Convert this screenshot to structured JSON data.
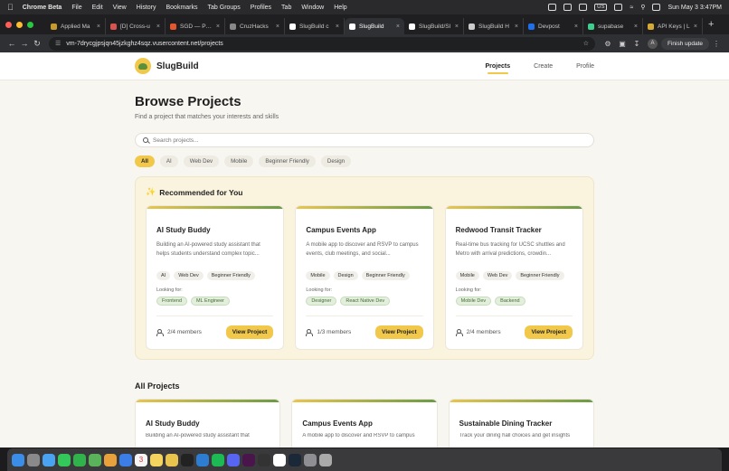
{
  "menubar": {
    "app": "Chrome Beta",
    "items": [
      "File",
      "Edit",
      "View",
      "History",
      "Bookmarks",
      "Tab Groups",
      "Profiles",
      "Tab",
      "Window",
      "Help"
    ],
    "input_source": "US",
    "clock": "Sun May 3  3:47PM"
  },
  "tabs": [
    {
      "label": "Applied Ma",
      "color": "#c79a2e"
    },
    {
      "label": "[D] Cross-u",
      "color": "#d9534f"
    },
    {
      "label": "SGD — PyTo",
      "color": "#e4572e"
    },
    {
      "label": "CruzHacks",
      "color": "#888888"
    },
    {
      "label": "SlugBuild c",
      "color": "#ffffff"
    },
    {
      "label": "SlugBuild",
      "color": "#ffffff"
    },
    {
      "label": "SlugBuild/Sl",
      "color": "#ffffff"
    },
    {
      "label": "SlugBuild H",
      "color": "#cccccc"
    },
    {
      "label": "Devpost",
      "color": "#1f6feb"
    },
    {
      "label": "supabase",
      "color": "#3ecf8e"
    },
    {
      "label": "API Keys | L",
      "color": "#d4a935"
    }
  ],
  "address": {
    "url": "vm-7drycgjpsjqn45jzkghz4sqz.vusercontent.net/projects",
    "update_label": "Finish update",
    "avatar_letter": "A"
  },
  "site": {
    "brand": "SlugBuild",
    "nav": [
      "Projects",
      "Create",
      "Profile"
    ]
  },
  "page": {
    "title": "Browse Projects",
    "subtitle": "Find a project that matches your interests and skills",
    "search_placeholder": "Search projects...",
    "filters": [
      "All",
      "AI",
      "Web Dev",
      "Mobile",
      "Beginner Friendly",
      "Design"
    ],
    "active_filter": "All"
  },
  "recommended": {
    "heading": "Recommended for You",
    "looking_label": "Looking for:",
    "cards": [
      {
        "title": "AI Study Buddy",
        "desc": "Building an AI-powered study assistant that helps students understand complex topic...",
        "tags": [
          "AI",
          "Web Dev",
          "Beginner Friendly"
        ],
        "roles": [
          "Frontend",
          "ML Engineer"
        ],
        "members": "2/4 members",
        "button": "View Project"
      },
      {
        "title": "Campus Events App",
        "desc": "A mobile app to discover and RSVP to campus events, club meetings, and social...",
        "tags": [
          "Mobile",
          "Design",
          "Beginner Friendly"
        ],
        "roles": [
          "Designer",
          "React Native Dev"
        ],
        "members": "1/3 members",
        "button": "View Project"
      },
      {
        "title": "Redwood Transit Tracker",
        "desc": "Real-time bus tracking for UCSC shuttles and Metro with arrival predictions, crowdin...",
        "tags": [
          "Mobile",
          "Web Dev",
          "Beginner Friendly"
        ],
        "roles": [
          "Mobile Dev",
          "Backend"
        ],
        "members": "2/4 members",
        "button": "View Project"
      }
    ]
  },
  "all_projects": {
    "heading": "All Projects",
    "cards": [
      {
        "title": "AI Study Buddy",
        "desc": "Building an AI-powered study assistant that"
      },
      {
        "title": "Campus Events App",
        "desc": "A mobile app to discover and RSVP to campus"
      },
      {
        "title": "Sustainable Dining Tracker",
        "desc": "Track your dining hall choices and get insights"
      }
    ]
  },
  "dock": {
    "icons": [
      "finder-icon",
      "launchpad-icon",
      "safari-icon",
      "messages-icon",
      "facetime-icon",
      "maps-icon",
      "photos-icon",
      "mail-icon",
      "calendar-icon",
      "notes-icon",
      "chrome-icon",
      "terminal-icon",
      "vscode-icon",
      "spotify-icon",
      "discord-icon",
      "slack-icon",
      "github-icon",
      "notion-icon",
      "steam-icon",
      "settings-icon",
      "trash-icon"
    ],
    "colors": [
      "#3b8ee8",
      "#8a8a8a",
      "#4aa3f0",
      "#34c759",
      "#2fb34a",
      "#5ab35a",
      "#e9a23b",
      "#3a7ee6",
      "#f5f5f5",
      "#f4d35e",
      "#e9c54d",
      "#222222",
      "#2d7dd2",
      "#1db954",
      "#5865f2",
      "#4a154b",
      "#333333",
      "#ffffff",
      "#1b2838",
      "#8e8e93",
      "#aaaaaa"
    ],
    "calendar_day": "3"
  }
}
